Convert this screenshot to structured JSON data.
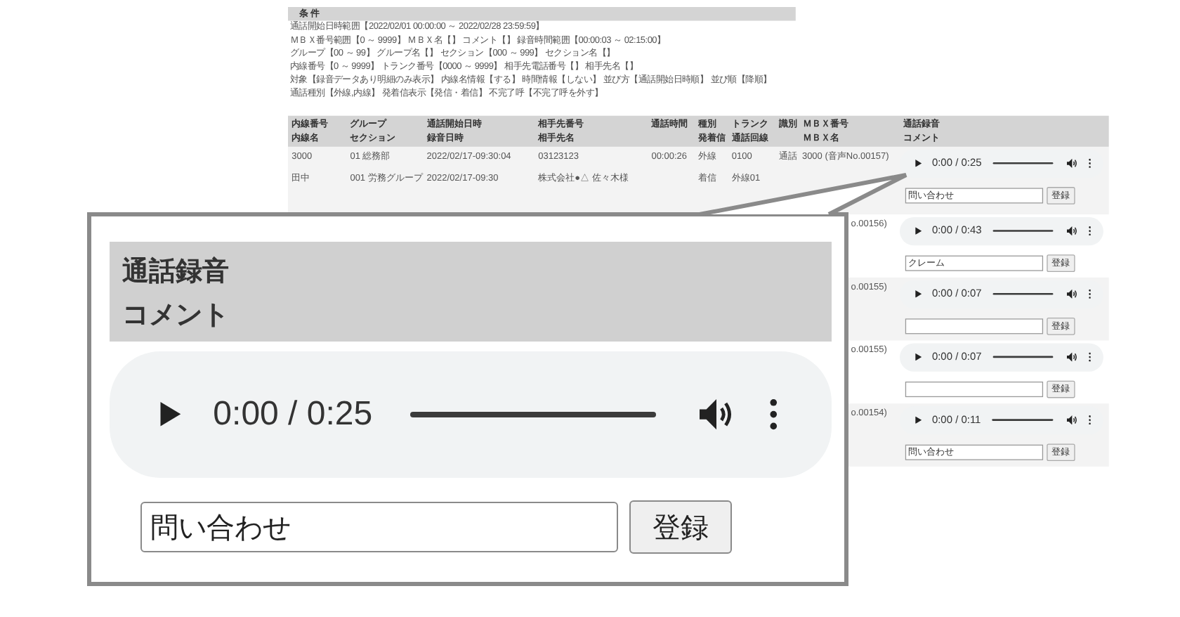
{
  "conditions": {
    "title": "条 件",
    "lines": [
      "通話開始日時範囲【2022/02/01 00:00:00 ～ 2022/02/28 23:59:59】",
      "ＭＢＸ番号範囲【0 ～ 9999】 ＭＢＸ名【】 コメント【】 録音時間範囲【00:00:03 ～ 02:15:00】",
      "グループ【00 ～ 99】 グループ名【】 セクション【000 ～ 999】 セクション名【】",
      "内線番号【0 ～ 9999】 トランク番号【0000 ～ 9999】 相手先電話番号【】 相手先名【】",
      "対象【録音データあり明細のみ表示】 内線名情報【する】 時間情報【しない】 並び方【通話開始日時順】 並び順【降順】",
      "通話種別【外線,内線】 発着信表示【発信・着信】 不完了呼【不完了呼を外す】"
    ]
  },
  "table": {
    "columns": [
      {
        "lines": [
          "内線番号",
          "内線名"
        ]
      },
      {
        "lines": [
          "グループ",
          "セクション"
        ]
      },
      {
        "lines": [
          "通話開始日時",
          "録音日時"
        ]
      },
      {
        "lines": [
          "相手先番号",
          "相手先名"
        ]
      },
      {
        "lines": [
          "通話時間"
        ]
      },
      {
        "lines": [
          "種別",
          "発着信"
        ]
      },
      {
        "lines": [
          "トランク",
          "通話回線"
        ]
      },
      {
        "lines": [
          "識別"
        ]
      },
      {
        "lines": [
          "ＭＢＸ番号",
          "ＭＢＸ名"
        ]
      },
      {
        "lines": [
          "通話録音",
          "コメント"
        ]
      }
    ],
    "rows": [
      {
        "cells": [
          [
            "3000",
            "田中"
          ],
          [
            "01 総務部",
            "001 労務グループ"
          ],
          [
            "2022/02/17-09:30:04",
            "2022/02/17-09:30"
          ],
          [
            "03123123",
            "株式会社●△ 佐々木様"
          ],
          [
            "00:00:26"
          ],
          [
            "外線",
            "着信"
          ],
          [
            "0100",
            "外線01"
          ],
          [
            "通話"
          ]
        ],
        "mbx": "3000 (音声No.00157)",
        "recording": {
          "time": "0:00 / 0:25"
        },
        "comment": "問い合わせ",
        "button": "登録"
      },
      {
        "mbx": "o.00156)",
        "recording": {
          "time": "0:00 / 0:43"
        },
        "comment": "クレーム",
        "button": "登録"
      },
      {
        "mbx": "o.00155)",
        "recording": {
          "time": "0:00 / 0:07"
        },
        "button": "登録"
      },
      {
        "mbx": "o.00155)",
        "recording": {
          "time": "0:00 / 0:07"
        },
        "button": "登録"
      },
      {
        "mbx": "o.00154)",
        "recording": {
          "time": "0:00 / 0:11"
        },
        "comment": "問い合わせ",
        "button": "登録"
      }
    ]
  },
  "callout": {
    "header": [
      "通話録音",
      "コメント"
    ],
    "recording": {
      "time": "0:00 / 0:25"
    },
    "comment": "問い合わせ",
    "button": "登録"
  }
}
